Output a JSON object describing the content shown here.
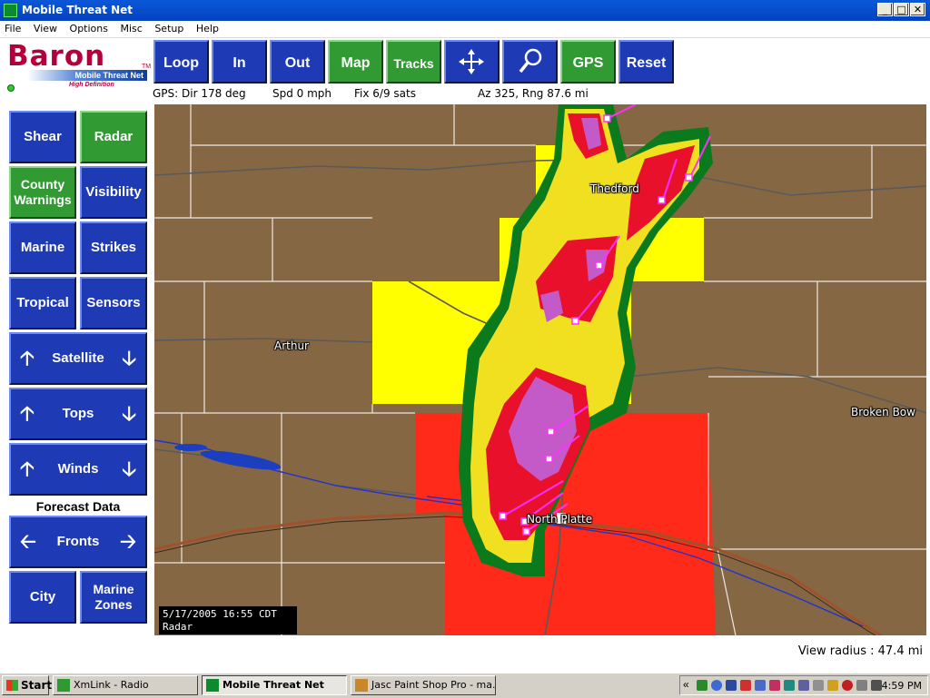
{
  "window": {
    "title": "Mobile Threat Net",
    "controls": [
      "_",
      "□",
      "✕"
    ]
  },
  "menu": [
    "File",
    "View",
    "Options",
    "Misc",
    "Setup",
    "Help"
  ],
  "logo": {
    "word": "Baron",
    "tagline": "Mobile Threat Net",
    "hd": "High Definition",
    "tm": "TM"
  },
  "toolbar": [
    {
      "label": "Loop",
      "style": "blue"
    },
    {
      "label": "In",
      "style": "blue"
    },
    {
      "label": "Out",
      "style": "blue"
    },
    {
      "label": "Map",
      "style": "green"
    },
    {
      "label": "Tracks",
      "style": "green"
    },
    {
      "label": "",
      "icon": "move-arrows-icon",
      "style": "blue"
    },
    {
      "label": "",
      "icon": "magnifier-icon",
      "style": "blue"
    },
    {
      "label": "GPS",
      "style": "green"
    },
    {
      "label": "Reset",
      "style": "blue"
    }
  ],
  "gps": {
    "dir": "GPS: Dir 178 deg",
    "spd": "Spd 0 mph",
    "fix": "Fix 6/9 sats",
    "az": "Az 325, Rng 87.6 mi"
  },
  "left_panel": {
    "shear": "Shear",
    "radar": "Radar",
    "county_warnings": [
      "County",
      "Warnings"
    ],
    "visibility": "Visibility",
    "marine": "Marine",
    "strikes": "Strikes",
    "tropical": "Tropical",
    "sensors": "Sensors",
    "satellite": "Satellite",
    "tops": "Tops",
    "winds": "Winds",
    "forecast_label": "Forecast Data",
    "fronts": "Fronts",
    "city": "City",
    "marine_zones": [
      "Marine",
      "Zones"
    ]
  },
  "map": {
    "cities": {
      "thedford": "Thedford",
      "arthur": "Arthur",
      "broken_bow": "Broken Bow",
      "north_platte": "North Platte"
    },
    "timestamp": "5/17/2005 16:55 CDT",
    "layer": "Radar",
    "colors": {
      "terrain": "#8a6a46",
      "watch_yellow": "#ffff00",
      "warning_red": "#ff2a1a",
      "storm_green": "#0b7a1c",
      "storm_magenta": "#c45ac8",
      "track_magenta": "#ff30ff"
    }
  },
  "view_radius": "View radius : 47.4 mi",
  "taskbar": {
    "start": "Start",
    "tasks": [
      "XmLink - Radio",
      "Mobile Threat Net",
      "Jasc Paint Shop Pro - ma..."
    ],
    "clock": "4:59 PM",
    "tray_chevron": "«"
  }
}
